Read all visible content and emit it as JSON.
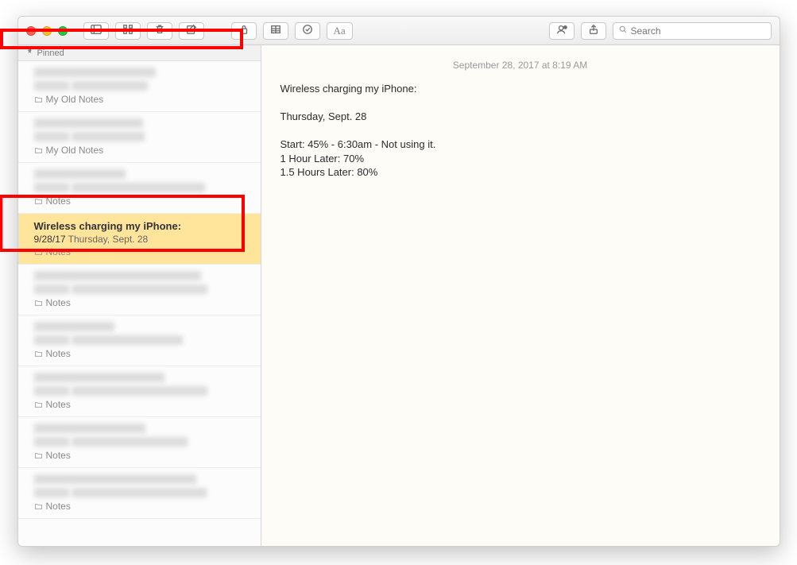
{
  "window": {
    "search_placeholder": "Search"
  },
  "sidebar": {
    "pinned_label": "Pinned",
    "items": [
      {
        "title_redacted": true,
        "date_redacted": true,
        "preview_redacted": true,
        "folder": "My Old Notes",
        "selected": false
      },
      {
        "title_redacted": true,
        "date_redacted": true,
        "preview_redacted": true,
        "folder": "My Old Notes",
        "selected": false
      },
      {
        "title_redacted": true,
        "date_redacted": true,
        "preview_redacted": true,
        "folder": "Notes",
        "selected": false
      },
      {
        "title": "Wireless charging my iPhone:",
        "date": "9/28/17",
        "preview": "Thursday, Sept. 28",
        "folder": "Notes",
        "selected": true
      },
      {
        "title_redacted": true,
        "date_redacted": true,
        "preview_redacted": true,
        "folder": "Notes",
        "selected": false
      },
      {
        "title_redacted": true,
        "date_redacted": true,
        "preview_redacted": true,
        "folder": "Notes",
        "selected": false
      },
      {
        "title_redacted": true,
        "date_redacted": true,
        "preview_redacted": true,
        "folder": "Notes",
        "selected": false
      },
      {
        "title_redacted": true,
        "date_redacted": true,
        "preview_redacted": true,
        "folder": "Notes",
        "selected": false
      },
      {
        "title_redacted": true,
        "date_redacted": true,
        "preview_redacted": true,
        "folder": "Notes",
        "selected": false
      }
    ]
  },
  "note": {
    "timestamp": "September 28, 2017 at 8:19 AM",
    "body": "Wireless charging my iPhone:\n\nThursday, Sept. 28\n\nStart: 45% - 6:30am - Not using it.\n1 Hour Later: 70%\n1.5 Hours Later: 80%"
  }
}
